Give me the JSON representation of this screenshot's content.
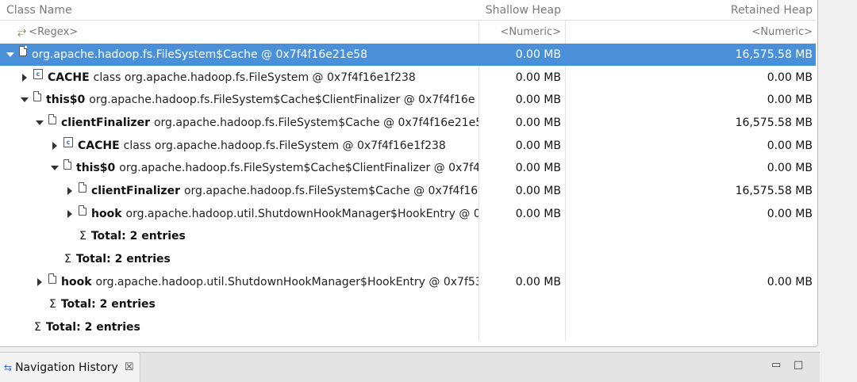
{
  "columns": {
    "class_name": "Class Name",
    "shallow_heap": "Shallow Heap",
    "retained_heap": "Retained Heap"
  },
  "filter": {
    "regex": "<Regex>",
    "numeric_shallow": "<Numeric>",
    "numeric_retained": "<Numeric>"
  },
  "rows": [
    {
      "bold": "",
      "name": "org.apache.hadoop.fs.FileSystem$Cache @ 0x7f4f16e21e58",
      "shallow": "0.00 MB",
      "retained": "16,575.58 MB"
    },
    {
      "bold": "CACHE",
      "name": "class org.apache.hadoop.fs.FileSystem @ 0x7f4f16e1f238",
      "shallow": "0.00 MB",
      "retained": "0.00 MB"
    },
    {
      "bold": "this$0",
      "name": "org.apache.hadoop.fs.FileSystem$Cache$ClientFinalizer @ 0x7f4f16e",
      "shallow": "0.00 MB",
      "retained": "0.00 MB"
    },
    {
      "bold": "clientFinalizer",
      "name": "org.apache.hadoop.fs.FileSystem$Cache @ 0x7f4f16e21e5",
      "shallow": "0.00 MB",
      "retained": "16,575.58 MB"
    },
    {
      "bold": "CACHE",
      "name": "class org.apache.hadoop.fs.FileSystem @ 0x7f4f16e1f238",
      "shallow": "0.00 MB",
      "retained": "0.00 MB"
    },
    {
      "bold": "this$0",
      "name": "org.apache.hadoop.fs.FileSystem$Cache$ClientFinalizer @ 0x7f4",
      "shallow": "0.00 MB",
      "retained": "0.00 MB"
    },
    {
      "bold": "clientFinalizer",
      "name": "org.apache.hadoop.fs.FileSystem$Cache @ 0x7f4f16e",
      "shallow": "0.00 MB",
      "retained": "16,575.58 MB"
    },
    {
      "bold": "hook",
      "name": "org.apache.hadoop.util.ShutdownHookManager$HookEntry @ 0:",
      "shallow": "0.00 MB",
      "retained": "0.00 MB"
    },
    {
      "total": "Total: 2 entries"
    },
    {
      "total": "Total: 2 entries"
    },
    {
      "bold": "hook",
      "name": "org.apache.hadoop.util.ShutdownHookManager$HookEntry @ 0x7f53",
      "shallow": "0.00 MB",
      "retained": "0.00 MB"
    },
    {
      "total": "Total: 2 entries"
    },
    {
      "total": "Total: 2 entries"
    }
  ],
  "bottom_panel": {
    "tab_label": "Navigation History",
    "close_symbol": "☒",
    "minimize_symbol": "▭",
    "maximize_symbol": "□"
  }
}
